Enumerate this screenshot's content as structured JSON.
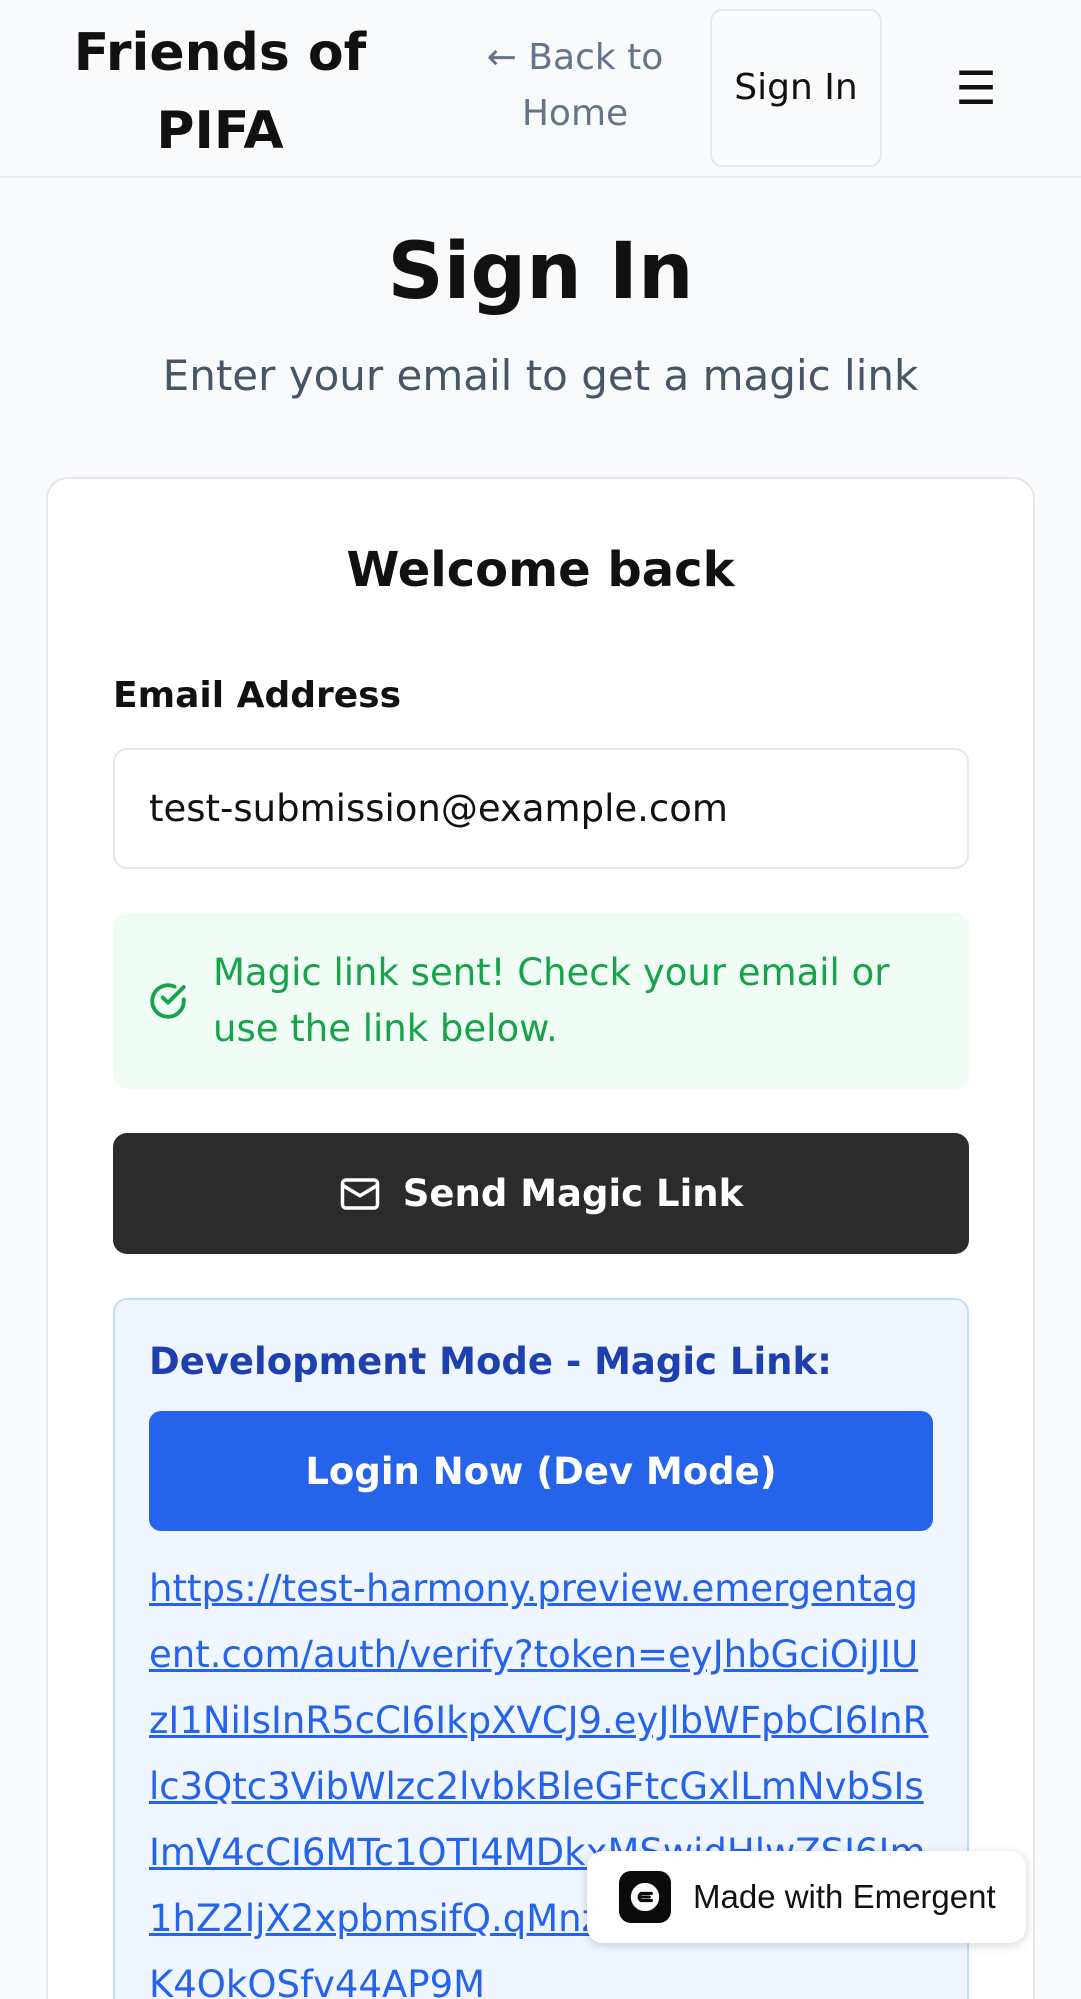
{
  "header": {
    "brand": "Friends of PIFA",
    "back_link": "← Back to Home",
    "sign_in": "Sign In",
    "menu_icon": "menu-icon"
  },
  "main": {
    "title": "Sign In",
    "subtitle": "Enter your email to get a magic link"
  },
  "form": {
    "card_title": "Welcome back",
    "email_label": "Email Address",
    "email_value": "test-submission@example.com",
    "success_message": "Magic link sent! Check your email or use the link below.",
    "send_button": "Send Magic Link"
  },
  "dev": {
    "title": "Development Mode - Magic Link:",
    "login_button": "Login Now (Dev Mode)",
    "link": "https://test-harmony.preview.emergentagent.com/auth/verify?token=eyJhbGciOiJIUzI1NiIsInR5cCI6IkpXVCJ9.eyJlbWFpbCI6InRlc3Qtc3VibWlzc2lvbkBleGFtcGxlLmNvbSIsImV4cCI6MTc1OTI4MDkxMSwidHlwZSI6Im1hZ2ljX2xpbmsifQ.qMnzmnlg8ZVcKL9U6vK4OkOSfv44AP9M"
  },
  "badge": {
    "text": "Made with Emergent"
  },
  "colors": {
    "success": "#16a34a",
    "primary_dark": "#2b2b2b",
    "dev_blue": "#2563eb"
  }
}
